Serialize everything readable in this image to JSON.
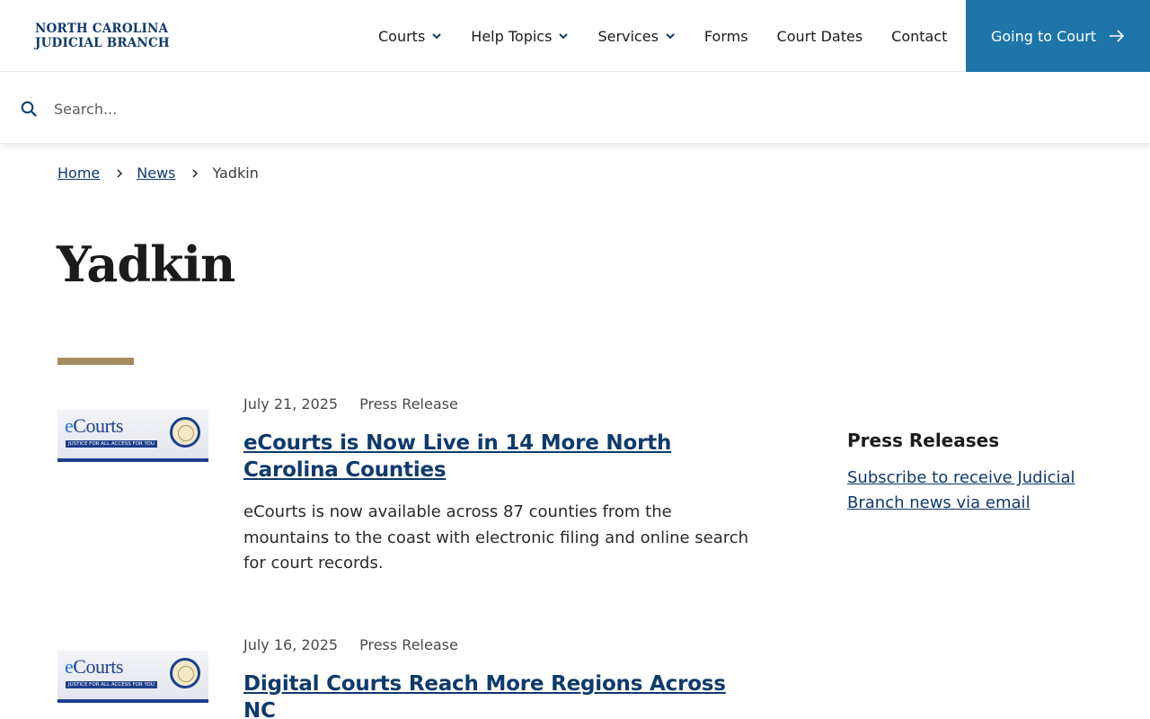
{
  "header": {
    "logo_line1": "NORTH CAROLINA",
    "logo_line2": "JUDICIAL BRANCH",
    "nav": [
      {
        "label": "Courts",
        "has_dropdown": true
      },
      {
        "label": "Help Topics",
        "has_dropdown": true
      },
      {
        "label": "Services",
        "has_dropdown": true
      },
      {
        "label": "Forms",
        "has_dropdown": false
      },
      {
        "label": "Court Dates",
        "has_dropdown": false
      },
      {
        "label": "Contact",
        "has_dropdown": false
      }
    ],
    "cta_label": "Going to Court"
  },
  "search": {
    "placeholder": "Search..."
  },
  "breadcrumb": {
    "home": "Home",
    "news": "News",
    "current": "Yadkin"
  },
  "page": {
    "title": "Yadkin"
  },
  "articles": [
    {
      "date": "July 21, 2025",
      "type": "Press Release",
      "headline": "eCourts is Now Live in 14 More North Carolina Counties",
      "summary": "eCourts is now available across 87 counties from the mountains to the coast with electronic filing and online search for court records.",
      "thumb_brand_a": "e",
      "thumb_brand_b": "Courts",
      "thumb_tag": "JUSTICE FOR ALL ACCESS FOR YOU"
    },
    {
      "date": "July 16, 2025",
      "type": "Press Release",
      "headline": "Digital Courts Reach More Regions Across NC",
      "summary": "",
      "thumb_brand_a": "e",
      "thumb_brand_b": "Courts",
      "thumb_tag": "JUSTICE FOR ALL ACCESS FOR YOU"
    }
  ],
  "sidebar": {
    "title": "Press Releases",
    "link": "Subscribe to receive Judicial Branch news via email"
  },
  "colors": {
    "primary": "#0f3a6b",
    "cta": "#1d75a8",
    "accent": "#a68b62"
  }
}
